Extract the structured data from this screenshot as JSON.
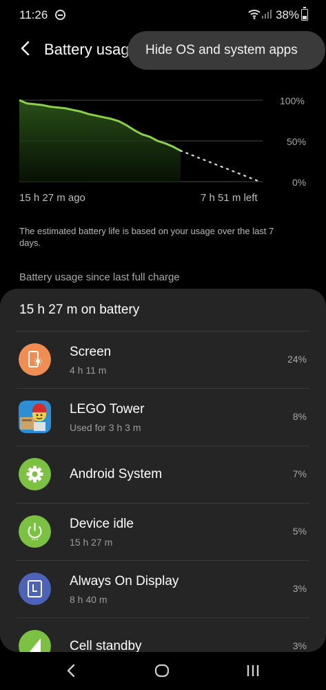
{
  "status_bar": {
    "time": "11:26",
    "battery_percent": "38%"
  },
  "header": {
    "title": "Battery usage",
    "back_icon": "back-arrow-icon"
  },
  "popup_menu": {
    "item": "Hide OS and system apps"
  },
  "chart_data": {
    "type": "line",
    "x_labels": [
      "15 h 27 m ago",
      "7 h 51 m left"
    ],
    "y_ticks": [
      "100%",
      "50%",
      "0%"
    ],
    "ylim": [
      0,
      100
    ],
    "series": [
      {
        "values": [
          100,
          96,
          95,
          94,
          92,
          91,
          90,
          88,
          86,
          83,
          81,
          79,
          77,
          74,
          69,
          63,
          58,
          55,
          50,
          47,
          43,
          38
        ]
      }
    ],
    "projection": {
      "from": 38,
      "to": 0
    },
    "colors": {
      "line": "#8bd14a",
      "projection": "#cfcfcf",
      "grid": "#4a4a4a"
    }
  },
  "note": "The estimated battery life is based on your usage over the last 7 days.",
  "section_title": "Battery usage since last full charge",
  "card": {
    "header": "15 h 27 m on battery",
    "items": [
      {
        "name": "Screen",
        "sub": "4 h 11 m",
        "percent": "24%",
        "icon": "screen-brightness-icon",
        "color": "#f08d52"
      },
      {
        "name": "LEGO Tower",
        "sub": "Used for 3 h 3 m",
        "percent": "8%",
        "icon": "lego-tower-app-icon",
        "color": "#2c8fd6"
      },
      {
        "name": "Android System",
        "sub": "",
        "percent": "7%",
        "icon": "gear-icon",
        "color": "#7cc242"
      },
      {
        "name": "Device idle",
        "sub": "15 h 27 m",
        "percent": "5%",
        "icon": "power-icon",
        "color": "#7cc242"
      },
      {
        "name": "Always On Display",
        "sub": "8 h 40 m",
        "percent": "3%",
        "icon": "clock-display-icon",
        "color": "#4c63b8"
      },
      {
        "name": "Cell standby",
        "sub": "",
        "percent": "3%",
        "icon": "cell-signal-icon",
        "color": "#7cc242"
      }
    ]
  },
  "nav": {
    "recents_icon": "recents-icon",
    "home_icon": "home-icon",
    "back_icon": "nav-back-icon"
  }
}
